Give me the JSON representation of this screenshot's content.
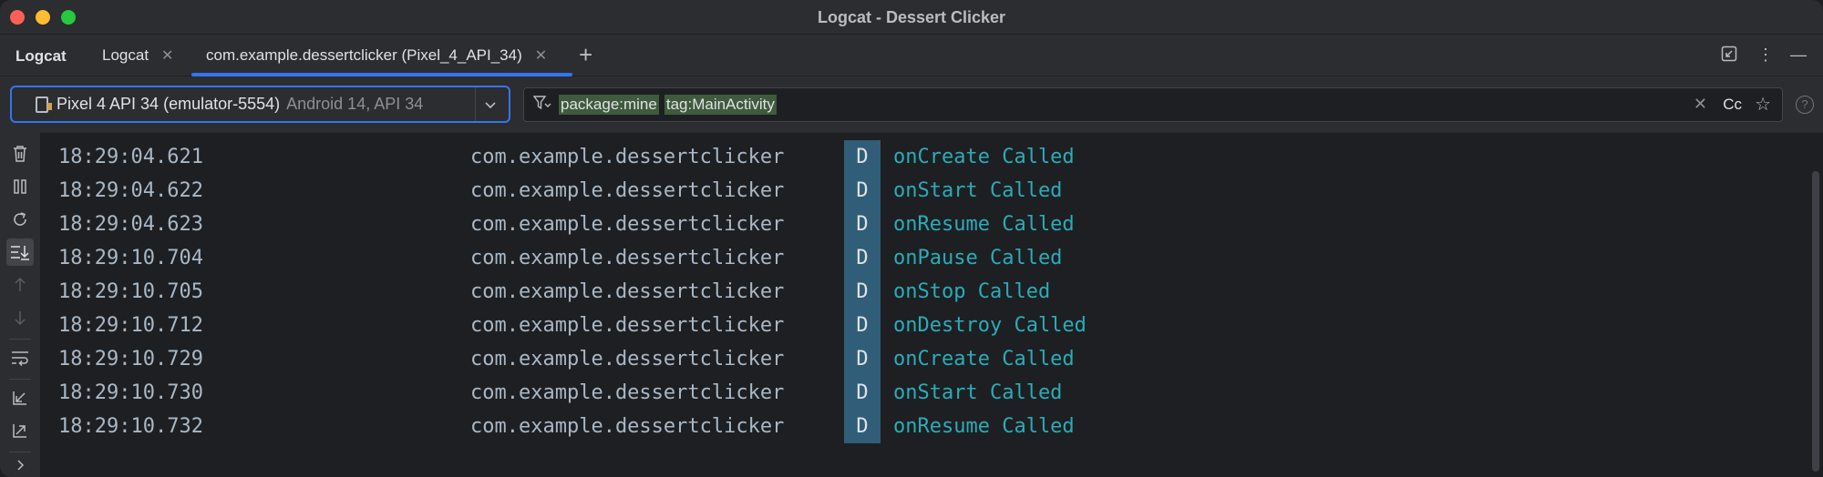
{
  "window": {
    "title": "Logcat - Dessert Clicker"
  },
  "tabbar": {
    "tool_title": "Logcat",
    "tabs": [
      {
        "label": "Logcat"
      },
      {
        "label": "com.example.dessertclicker (Pixel_4_API_34)"
      }
    ]
  },
  "device": {
    "name": "Pixel 4 API 34 (emulator-5554)",
    "detail": "Android 14, API 34"
  },
  "filter": {
    "terms": [
      "package:mine",
      "tag:MainActivity"
    ],
    "case_toggle": "Cc"
  },
  "log": {
    "rows": [
      {
        "time": "18:29:04.621",
        "package": "com.example.dessertclicker",
        "level": "D",
        "message": "onCreate Called"
      },
      {
        "time": "18:29:04.622",
        "package": "com.example.dessertclicker",
        "level": "D",
        "message": "onStart Called"
      },
      {
        "time": "18:29:04.623",
        "package": "com.example.dessertclicker",
        "level": "D",
        "message": "onResume Called"
      },
      {
        "time": "18:29:10.704",
        "package": "com.example.dessertclicker",
        "level": "D",
        "message": "onPause Called"
      },
      {
        "time": "18:29:10.705",
        "package": "com.example.dessertclicker",
        "level": "D",
        "message": "onStop Called"
      },
      {
        "time": "18:29:10.712",
        "package": "com.example.dessertclicker",
        "level": "D",
        "message": "onDestroy Called"
      },
      {
        "time": "18:29:10.729",
        "package": "com.example.dessertclicker",
        "level": "D",
        "message": "onCreate Called"
      },
      {
        "time": "18:29:10.730",
        "package": "com.example.dessertclicker",
        "level": "D",
        "message": "onStart Called"
      },
      {
        "time": "18:29:10.732",
        "package": "com.example.dessertclicker",
        "level": "D",
        "message": "onResume Called"
      }
    ]
  },
  "colors": {
    "accent": "#3574f0",
    "level_badge": "#305d78",
    "message": "#2aacb8",
    "filter_highlight": "#3f5a3c"
  },
  "icons": {
    "left_toolbar": [
      "trash-icon",
      "pause-icon",
      "restart-icon",
      "scroll-to-end-icon",
      "up-arrow-icon",
      "down-arrow-icon",
      "soft-wrap-icon",
      "import-icon",
      "export-icon",
      "expand-icon"
    ]
  }
}
